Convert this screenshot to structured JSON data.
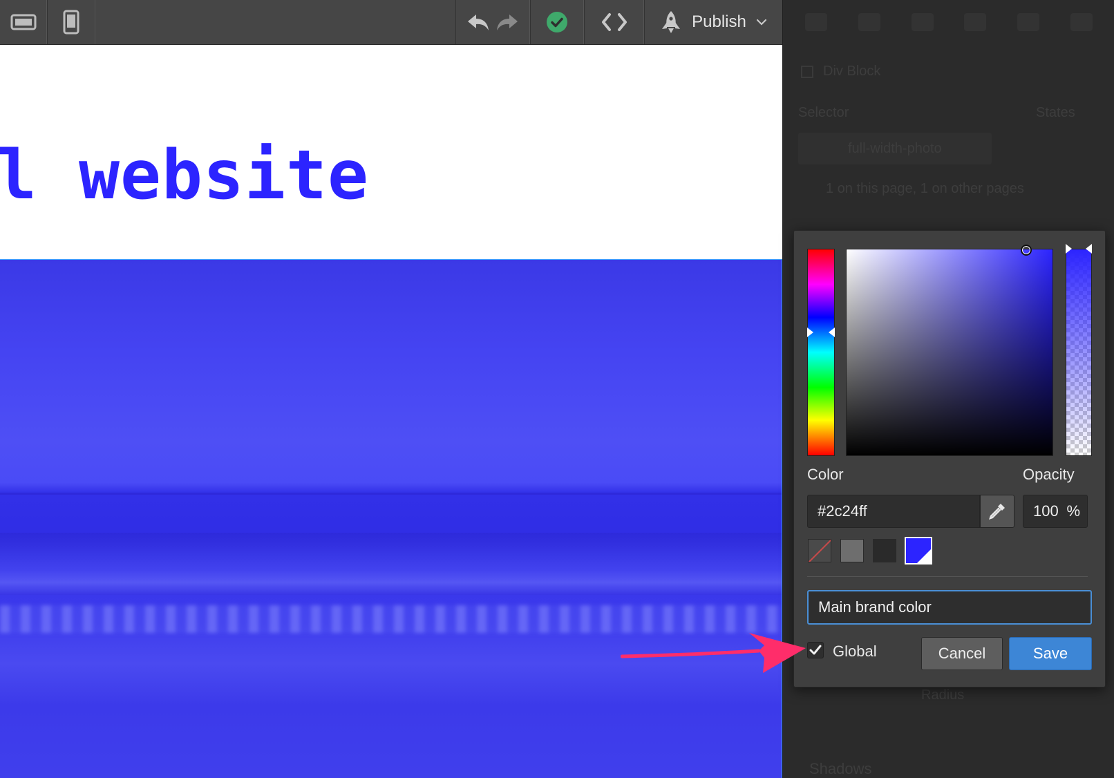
{
  "toolbar": {
    "publish_label": "Publish",
    "icons": [
      "desktop-view-icon",
      "mobile-view-icon",
      "undo-icon",
      "redo-icon",
      "status-check-icon",
      "code-icon",
      "rocket-icon",
      "chevron-down-icon"
    ]
  },
  "canvas": {
    "heading": "l website",
    "brand_color": "#2c24ff"
  },
  "style_panel": {
    "element_type": "Div Block",
    "selector_label": "Selector",
    "states_label": "States",
    "selector_class": "full-width-photo",
    "page_count": "1 on this page, 1 on other pages",
    "radius_label": "Radius",
    "shadows_label": "Shadows"
  },
  "picker": {
    "color_label": "Color",
    "opacity_label": "Opacity",
    "hex_value": "#2c24ff",
    "opacity_value": "100",
    "opacity_unit": "%",
    "swatches": [
      "#none",
      "#6e6e6e",
      "#2a2a2a",
      "#2c24ff"
    ],
    "name_value": "Main brand color",
    "global_label": "Global",
    "global_checked": true,
    "cancel_label": "Cancel",
    "save_label": "Save"
  },
  "colors": {
    "accent": "#3d86d6",
    "annotation": "#ff2d6a",
    "toolbar_bg": "#464646",
    "panel_bg": "#2b2b2b"
  }
}
